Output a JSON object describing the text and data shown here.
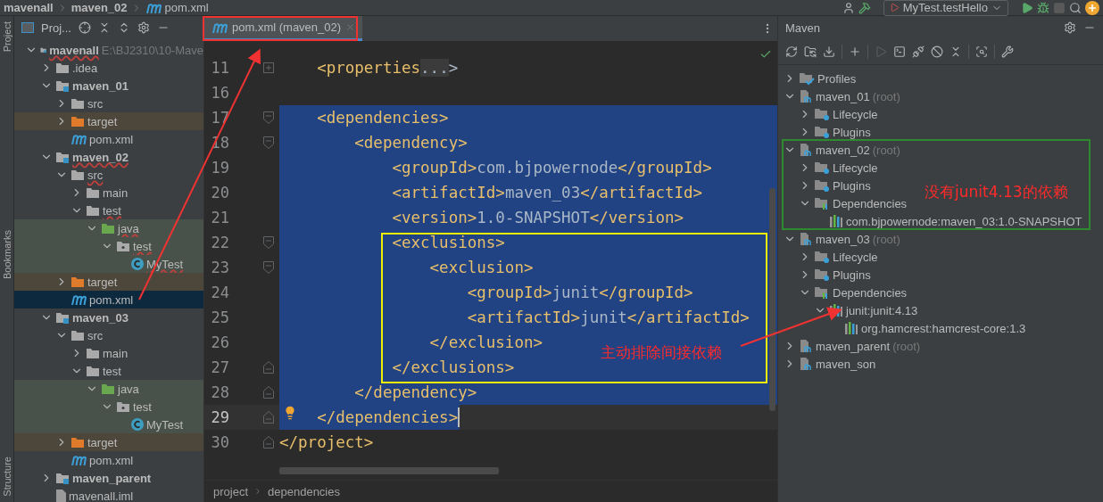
{
  "breadcrumbs": [
    {
      "label": "mavenall",
      "kind": "module"
    },
    {
      "label": "maven_02",
      "kind": "module"
    },
    {
      "label": "pom.xml",
      "kind": "pom"
    }
  ],
  "run_config": {
    "label": "MyTest.testHello"
  },
  "side_stripe": [
    {
      "label": "Project"
    },
    {
      "label": "Bookmarks"
    },
    {
      "label": "Structure"
    }
  ],
  "project_panel": {
    "title": "Proj...",
    "tree": [
      {
        "label": "mavenall",
        "kind": "module",
        "path": "E:\\BJ2310\\10-Mave",
        "error": true,
        "expanded": true,
        "selected": false,
        "children": [
          {
            "label": ".idea",
            "kind": "folder",
            "error": false,
            "expanded": false,
            "selected": false
          },
          {
            "label": "maven_01",
            "kind": "module",
            "error": false,
            "expanded": true,
            "selected": false,
            "children": [
              {
                "label": "src",
                "kind": "folder",
                "error": false,
                "expanded": false,
                "selected": false
              },
              {
                "label": "target",
                "kind": "excluded",
                "error": false,
                "expanded": false,
                "selected": false
              },
              {
                "label": "pom.xml",
                "kind": "pom",
                "error": false,
                "selected": false
              }
            ]
          },
          {
            "label": "maven_02",
            "kind": "module",
            "error": true,
            "expanded": true,
            "selected": false,
            "children": [
              {
                "label": "src",
                "kind": "folder",
                "error": true,
                "expanded": true,
                "selected": false,
                "children": [
                  {
                    "label": "main",
                    "kind": "folder",
                    "error": false,
                    "expanded": false,
                    "selected": false
                  },
                  {
                    "label": "test",
                    "kind": "folder",
                    "error": true,
                    "expanded": true,
                    "selected": false,
                    "children": [
                      {
                        "label": "java",
                        "kind": "test_root",
                        "error": true,
                        "expanded": true,
                        "selected": false,
                        "children": [
                          {
                            "label": "test",
                            "kind": "package",
                            "error": true,
                            "expanded": true,
                            "selected": false,
                            "children": [
                              {
                                "label": "MyTest",
                                "kind": "class",
                                "error": true,
                                "selected": false
                              }
                            ]
                          }
                        ]
                      }
                    ]
                  }
                ]
              },
              {
                "label": "target",
                "kind": "excluded",
                "error": false,
                "expanded": false,
                "selected": false
              },
              {
                "label": "pom.xml",
                "kind": "pom",
                "error": false,
                "selected": true
              }
            ]
          },
          {
            "label": "maven_03",
            "kind": "module",
            "error": false,
            "expanded": true,
            "selected": false,
            "children": [
              {
                "label": "src",
                "kind": "folder",
                "error": false,
                "expanded": true,
                "selected": false,
                "children": [
                  {
                    "label": "main",
                    "kind": "folder",
                    "error": false,
                    "expanded": false,
                    "selected": false
                  },
                  {
                    "label": "test",
                    "kind": "folder",
                    "error": false,
                    "expanded": true,
                    "selected": false,
                    "children": [
                      {
                        "label": "java",
                        "kind": "test_root",
                        "error": false,
                        "expanded": true,
                        "selected": false,
                        "children": [
                          {
                            "label": "test",
                            "kind": "package",
                            "error": false,
                            "expanded": true,
                            "selected": false,
                            "children": [
                              {
                                "label": "MyTest",
                                "kind": "class",
                                "error": false,
                                "selected": false
                              }
                            ]
                          }
                        ]
                      }
                    ]
                  }
                ]
              },
              {
                "label": "target",
                "kind": "excluded",
                "error": false,
                "expanded": false,
                "selected": false
              },
              {
                "label": "pom.xml",
                "kind": "pom",
                "error": false,
                "selected": false
              }
            ]
          },
          {
            "label": "maven_parent",
            "kind": "module",
            "error": false,
            "expanded": false,
            "selected": false
          },
          {
            "label": "mavenall.iml",
            "kind": "iml",
            "selected": false
          }
        ]
      }
    ]
  },
  "editor": {
    "tab": {
      "label": "pom.xml (maven_02)",
      "selected": true
    },
    "lines": [
      {
        "number": "11",
        "code": "    <properties",
        "folded_text": "...",
        "code_after": ">",
        "fold_start": false,
        "fold_end": false,
        "selected": false
      },
      {
        "number": "16",
        "fold_start": false,
        "fold_end": false,
        "selected": false
      },
      {
        "number": "17",
        "code": "    <dependencies>",
        "fold_start": true,
        "fold_end": false,
        "selected": true
      },
      {
        "number": "18",
        "code": "        <dependency>",
        "fold_start": true,
        "fold_end": false,
        "selected": true
      },
      {
        "number": "19",
        "code": "            <groupId>com.bjpowernode</groupId>",
        "fold_start": false,
        "fold_end": false,
        "selected": true
      },
      {
        "number": "20",
        "code": "            <artifactId>maven_03</artifactId>",
        "fold_start": false,
        "fold_end": false,
        "selected": true
      },
      {
        "number": "21",
        "code": "            <version>1.0-SNAPSHOT</version>",
        "fold_start": false,
        "fold_end": false,
        "selected": true
      },
      {
        "number": "22",
        "code": "            <exclusions>",
        "fold_start": true,
        "fold_end": false,
        "selected": true
      },
      {
        "number": "23",
        "code": "                <exclusion>",
        "fold_start": true,
        "fold_end": false,
        "selected": true
      },
      {
        "number": "24",
        "code": "                    <groupId>junit</groupId>",
        "fold_start": false,
        "fold_end": false,
        "selected": true
      },
      {
        "number": "25",
        "code": "                    <artifactId>junit</artifactId>",
        "fold_start": false,
        "fold_end": false,
        "selected": true
      },
      {
        "number": "26",
        "code": "                </exclusion>",
        "fold_start": false,
        "fold_end": false,
        "selected": true
      },
      {
        "number": "27",
        "code": "            </exclusions>",
        "fold_start": false,
        "fold_end": true,
        "selected": true
      },
      {
        "number": "28",
        "code": "        </dependency>",
        "fold_start": false,
        "fold_end": true,
        "selected": true
      },
      {
        "number": "29",
        "code": "    </dependencies>",
        "fold_start": false,
        "fold_end": true,
        "selected": true,
        "caret": true
      },
      {
        "number": "30",
        "code": "</project>",
        "fold_start": false,
        "fold_end": true,
        "selected": false
      }
    ],
    "breadcrumbs": [
      {
        "label": "project"
      },
      {
        "label": "dependencies"
      }
    ]
  },
  "maven_panel": {
    "title": "Maven",
    "tree": [
      {
        "label": "Profiles",
        "kind": "profiles",
        "expanded": false
      },
      {
        "label": "maven_01",
        "suffix": "(root)",
        "kind": "project",
        "expanded": true,
        "children": [
          {
            "label": "Lifecycle",
            "kind": "lifecycle",
            "expanded": false
          },
          {
            "label": "Plugins",
            "kind": "plugins",
            "expanded": false
          }
        ]
      },
      {
        "label": "maven_02",
        "suffix": "(root)",
        "kind": "project",
        "expanded": true,
        "children": [
          {
            "label": "Lifecycle",
            "kind": "lifecycle",
            "expanded": false
          },
          {
            "label": "Plugins",
            "kind": "plugins",
            "expanded": false
          },
          {
            "label": "Dependencies",
            "kind": "dependencies",
            "expanded": true,
            "children": [
              {
                "label": "com.bjpowernode:maven_03:1.0-SNAPSHOT",
                "kind": "artifact"
              }
            ]
          }
        ]
      },
      {
        "label": "maven_03",
        "suffix": "(root)",
        "kind": "project",
        "expanded": true,
        "children": [
          {
            "label": "Lifecycle",
            "kind": "lifecycle",
            "expanded": false
          },
          {
            "label": "Plugins",
            "kind": "plugins",
            "expanded": false
          },
          {
            "label": "Dependencies",
            "kind": "dependencies",
            "expanded": true,
            "children": [
              {
                "label": "junit:junit:4.13",
                "kind": "artifact",
                "expanded": true,
                "children": [
                  {
                    "label": "org.hamcrest:hamcrest-core:1.3",
                    "kind": "artifact"
                  }
                ]
              }
            ]
          }
        ]
      },
      {
        "label": "maven_parent",
        "suffix": "(root)",
        "kind": "project",
        "expanded": false
      },
      {
        "label": "maven_son",
        "kind": "project",
        "expanded": false
      }
    ]
  },
  "annotations": [
    {
      "text": "没有junit4.13的依赖"
    },
    {
      "text": "主动排除间接依赖"
    }
  ]
}
